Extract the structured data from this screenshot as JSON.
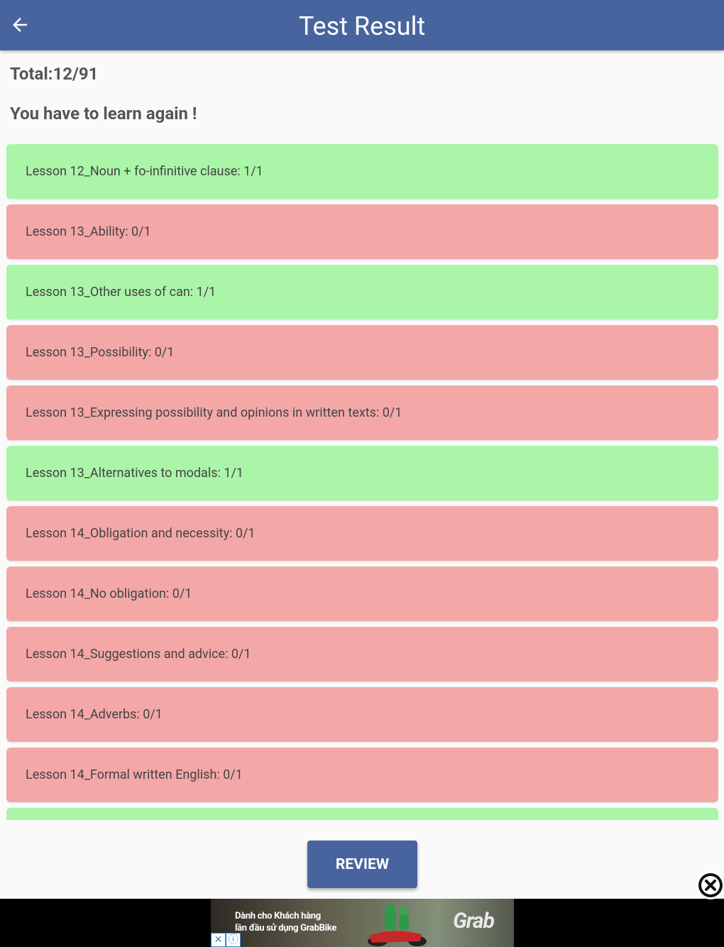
{
  "appbar": {
    "title": "Test Result"
  },
  "summary": {
    "total": "Total:12/91",
    "message": "You have to learn again !"
  },
  "results": [
    {
      "label": "Lesson 12_Noun + fo-infinitive clause: 1/1",
      "status": "pass"
    },
    {
      "label": "Lesson 13_Ability: 0/1",
      "status": "fail"
    },
    {
      "label": "Lesson 13_Other uses of can: 1/1",
      "status": "pass"
    },
    {
      "label": "Lesson 13_Possibility: 0/1",
      "status": "fail"
    },
    {
      "label": "Lesson 13_Expressing possibility and opinions in written texts: 0/1",
      "status": "fail"
    },
    {
      "label": "Lesson 13_Alternatives to modals: 1/1",
      "status": "pass"
    },
    {
      "label": "Lesson 14_Obligation and necessity: 0/1",
      "status": "fail"
    },
    {
      "label": "Lesson 14_No obligation: 0/1",
      "status": "fail"
    },
    {
      "label": "Lesson 14_Suggestions and advice: 0/1",
      "status": "fail"
    },
    {
      "label": "Lesson 14_Adverbs: 0/1",
      "status": "fail"
    },
    {
      "label": "Lesson 14_Formal written English: 0/1",
      "status": "fail"
    },
    {
      "label": "",
      "status": "pass"
    }
  ],
  "actions": {
    "review_label": "REVIEW"
  },
  "ad": {
    "line1": "Dành cho Khách hàng",
    "line2": "lần đầu sử dụng GrabBike",
    "brand": "Grab"
  },
  "colors": {
    "appbar": "#47649e",
    "pass": "#aaf5a8",
    "fail": "#f4a7a7",
    "button": "#47649e"
  },
  "icons": {
    "back": "arrow-left-icon",
    "ad_close": "close-circle-icon",
    "adchoices_close": "x-icon",
    "adchoices_info": "info-icon"
  }
}
